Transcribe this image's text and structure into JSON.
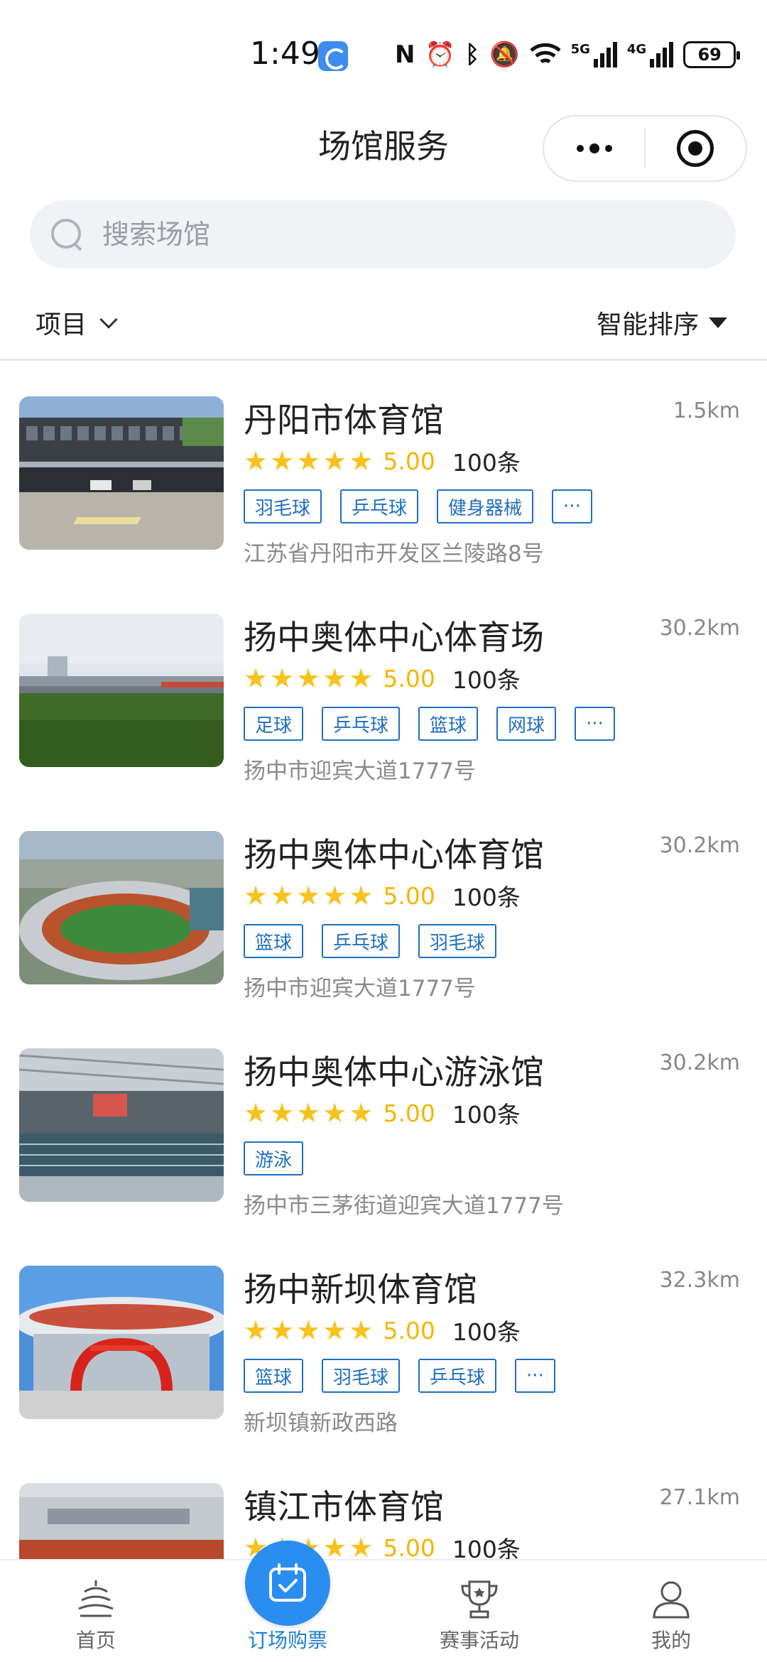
{
  "status_bar": {
    "time": "1:49",
    "signal1_label": "5G",
    "signal2_label": "4G",
    "battery": "69"
  },
  "nav": {
    "title": "场馆服务"
  },
  "search": {
    "placeholder": "搜索场馆"
  },
  "filters": {
    "project_label": "项目",
    "sort_label": "智能排序"
  },
  "venues": [
    {
      "name": "丹阳市体育馆",
      "distance": "1.5km",
      "score": "5.00",
      "reviews": "100条",
      "tags": [
        "羽毛球",
        "乒乓球",
        "健身器械",
        "···"
      ],
      "address": "江苏省丹阳市开发区兰陵路8号"
    },
    {
      "name": "扬中奥体中心体育场",
      "distance": "30.2km",
      "score": "5.00",
      "reviews": "100条",
      "tags": [
        "足球",
        "乒乓球",
        "篮球",
        "网球",
        "···"
      ],
      "address": "扬中市迎宾大道1777号"
    },
    {
      "name": "扬中奥体中心体育馆",
      "distance": "30.2km",
      "score": "5.00",
      "reviews": "100条",
      "tags": [
        "篮球",
        "乒乓球",
        "羽毛球"
      ],
      "address": "扬中市迎宾大道1777号"
    },
    {
      "name": "扬中奥体中心游泳馆",
      "distance": "30.2km",
      "score": "5.00",
      "reviews": "100条",
      "tags": [
        "游泳"
      ],
      "address": "扬中市三茅街道迎宾大道1777号"
    },
    {
      "name": "扬中新坝体育馆",
      "distance": "32.3km",
      "score": "5.00",
      "reviews": "100条",
      "tags": [
        "篮球",
        "羽毛球",
        "乒乓球",
        "···"
      ],
      "address": "新坝镇新政西路"
    },
    {
      "name": "镇江市体育馆",
      "distance": "27.1km",
      "score": "5.00",
      "reviews": "100条",
      "tags": [],
      "address": ""
    }
  ],
  "tabbar": {
    "home": "首页",
    "booking": "订场购票",
    "events": "赛事活动",
    "mine": "我的"
  },
  "colors": {
    "accent": "#1d7fd8",
    "star": "#f7c21c",
    "tag_border": "#1f6fc0"
  }
}
